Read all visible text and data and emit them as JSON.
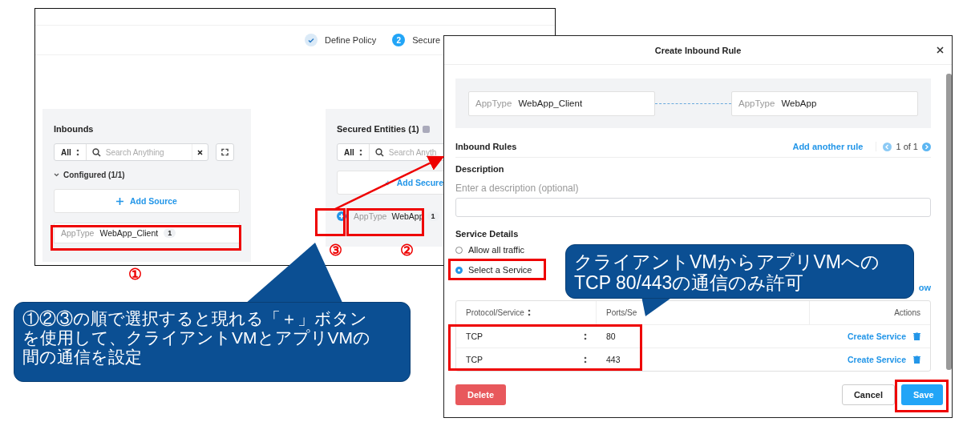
{
  "background_window": {
    "stepper": [
      {
        "kind": "done",
        "label": "Define Policy"
      },
      {
        "kind": "current",
        "number": "2",
        "label": "Secure"
      }
    ],
    "inbounds": {
      "title": "Inbounds",
      "filter": "All",
      "search_placeholder": "Search Anything",
      "group": {
        "label": "Configured (1/1)",
        "expanded": true
      },
      "add_button": "Add Source",
      "entity": {
        "type": "AppType",
        "name": "WebApp_Client",
        "count": "1"
      }
    },
    "secured_entities": {
      "title": "Secured Entities (1)",
      "filter": "All",
      "search_placeholder": "Search Anyth",
      "add_button": "Add Secure",
      "entity": {
        "type": "AppType",
        "name": "WebApp",
        "count": "1"
      }
    }
  },
  "dialog": {
    "title": "Create Inbound Rule",
    "source": {
      "type": "AppType",
      "name": "WebApp_Client"
    },
    "target": {
      "type": "AppType",
      "name": "WebApp"
    },
    "inbound_rules": {
      "label": "Inbound Rules",
      "add_link": "Add another rule",
      "pager": "1 of 1"
    },
    "description": {
      "label": "Description",
      "hint": "Enter a description (optional)"
    },
    "service_details": {
      "label": "Service Details",
      "options": [
        {
          "label": "Allow all traffic",
          "selected": false
        },
        {
          "label": "Select a Service",
          "selected": true
        }
      ],
      "link": "ow"
    },
    "table": {
      "columns": [
        "Protocol/Service",
        "Ports/Se",
        "Actions"
      ],
      "rows": [
        {
          "protocol": "TCP",
          "ports": "80",
          "action": "Create Service"
        },
        {
          "protocol": "TCP",
          "ports": "443",
          "action": "Create Service"
        }
      ]
    },
    "buttons": {
      "delete": "Delete",
      "cancel": "Cancel",
      "save": "Save"
    }
  },
  "annotations": {
    "markers": [
      "①",
      "②",
      "③"
    ],
    "callouts": [
      {
        "lines": [
          "クライアントVMからアプリVMへの",
          "TCP 80/443の通信のみ許可"
        ]
      },
      {
        "lines": [
          "①②③の順で選択すると現れる「＋」ボタン",
          "を使用して、クライアントVMとアプリVMの",
          "間の通信を設定"
        ]
      }
    ]
  }
}
